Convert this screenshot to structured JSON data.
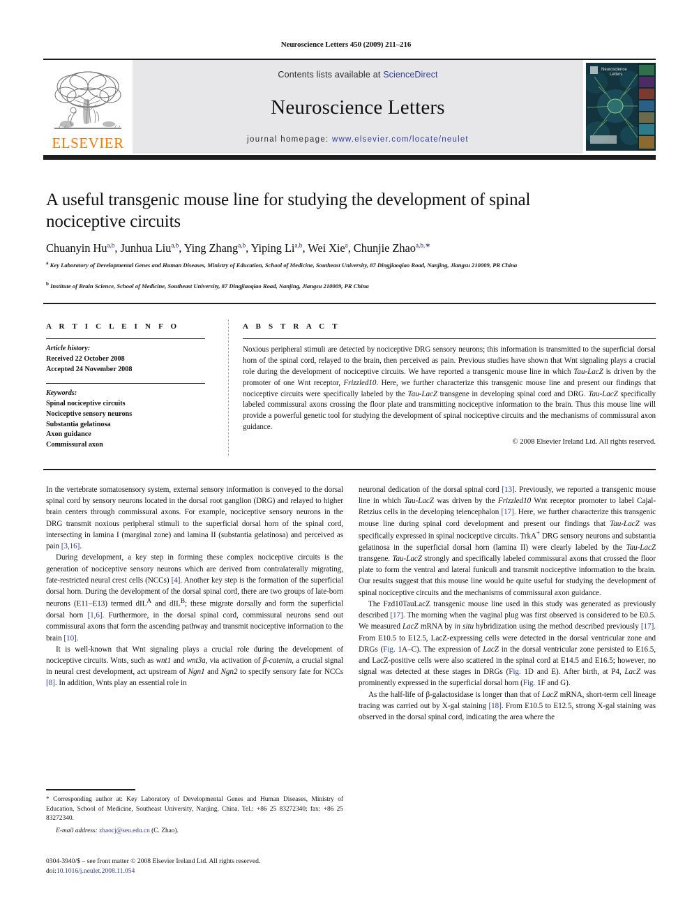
{
  "running_head": "Neuroscience Letters 450 (2009) 211–216",
  "masthead": {
    "publisher_name": "ELSEVIER",
    "contents_prefix": "Contents lists available at ",
    "contents_link": "ScienceDirect",
    "journal_title": "Neuroscience Letters",
    "homepage_prefix": "journal homepage: ",
    "homepage_url": "www.elsevier.com/locate/neulet",
    "cover_title": "Neuroscience Letters",
    "link_color": "#2f3b9e",
    "band_color": "#e7e7e9",
    "elsevier_orange": "#F57C00"
  },
  "article": {
    "title": "A useful transgenic mouse line for studying the development of spinal nociceptive circuits",
    "authors_html": "Chuanyin Hu<sup>a,b</sup>, Junhua Liu<sup>a,b</sup>, Ying Zhang<sup>a,b</sup>, Yiping Li<sup>a,b</sup>, Wei Xie<sup>a</sup>, Chunjie Zhao<sup>a,b,∗</sup>",
    "affiliation_a": "Key Laboratory of Developmental Genes and Human Diseases, Ministry of Education, School of Medicine, Southeast University, 87 Dingjiaoqiao Road, Nanjing, Jiangsu 210009, PR China",
    "affiliation_b": "Institute of Brain Science, School of Medicine, Southeast University, 87 Dingjiaoqiao Road, Nanjing, Jiangsu 210009, PR China"
  },
  "info": {
    "kicker": "A R T I C L E    I N F O",
    "history_label": "Article history:",
    "received": "Received 22 October 2008",
    "accepted": "Accepted 24 November 2008",
    "keywords_label": "Keywords:",
    "keywords": [
      "Spinal nociceptive circuits",
      "Nociceptive sensory neurons",
      "Substantia gelatinosa",
      "Axon guidance",
      "Commissural axon"
    ]
  },
  "abstract": {
    "kicker": "A B S T R A C T",
    "text": "Noxious peripheral stimuli are detected by nociceptive DRG sensory neurons; this information is transmitted to the superficial dorsal horn of the spinal cord, relayed to the brain, then perceived as pain. Previous studies have shown that Wnt signaling plays a crucial role during the development of nociceptive circuits. We have reported a transgenic mouse line in which Tau-LacZ is driven by the promoter of one Wnt receptor, Frizzled10. Here, we further characterize this transgenic mouse line and present our findings that nociceptive circuits were specifically labeled by the Tau-LacZ transgene in developing spinal cord and DRG. Tau-LacZ specifically labeled commissural axons crossing the floor plate and transmitting nociceptive information to the brain. Thus this mouse line will provide a powerful genetic tool for studying the development of spinal nociceptive circuits and the mechanisms of commissural axon guidance.",
    "copyright": "© 2008 Elsevier Ireland Ltd. All rights reserved."
  },
  "body": {
    "left_paragraphs": [
      "In the vertebrate somatosensory system, external sensory information is conveyed to the dorsal spinal cord by sensory neurons located in the dorsal root ganglion (DRG) and relayed to higher brain centers through commissural axons. For example, nociceptive sensory neurons in the DRG transmit noxious peripheral stimuli to the superficial dorsal horn of the spinal cord, intersecting in lamina I (marginal zone) and lamina II (substantia gelatinosa) and perceived as pain [3,16].",
      "During development, a key step in forming these complex nociceptive circuits is the generation of nociceptive sensory neurons which are derived from contralaterally migrating, fate-restricted neural crest cells (NCCs) [4]. Another key step is the formation of the superficial dorsal horn. During the development of the dorsal spinal cord, there are two groups of late-born neurons (E11–E13) termed dIL^A and dIL^B; these migrate dorsally and form the superficial dorsal horn [1,6]. Furthermore, in the dorsal spinal cord, commissural neurons send out commissural axons that form the ascending pathway and transmit nociceptive information to the brain [10].",
      "It is well-known that Wnt signaling plays a crucial role during the development of nociceptive circuits. Wnts, such as wnt1 and wnt3a, via activation of β-catenin, a crucial signal in neural crest development, act upstream of Ngn1 and Ngn2 to specify sensory fate for NCCs [8]. In addition, Wnts play an essential role in"
    ],
    "right_paragraphs": [
      "neuronal dedication of the dorsal spinal cord [13]. Previously, we reported a transgenic mouse line in which Tau-LacZ was driven by the Frizzled10 Wnt receptor promoter to label Cajal-Retzius cells in the developing telencephalon [17]. Here, we further characterize this transgenic mouse line during spinal cord development and present our findings that Tau-LacZ was specifically expressed in spinal nociceptive circuits. TrkA+ DRG sensory neurons and substantia gelatinosa in the superficial dorsal horn (lamina II) were clearly labeled by the Tau-LacZ transgene. Tau-LacZ strongly and specifically labeled commissural axons that crossed the floor plate to form the ventral and lateral funiculi and transmit nociceptive information to the brain. Our results suggest that this mouse line would be quite useful for studying the development of spinal nociceptive circuits and the mechanisms of commissural axon guidance.",
      "The Fzd10TauLacZ transgenic mouse line used in this study was generated as previously described [17]. The morning when the vaginal plug was first observed is considered to be E0.5. We measured LacZ mRNA by in situ hybridization using the method described previously [17]. From E10.5 to E12.5, LacZ-expressing cells were detected in the dorsal ventricular zone and DRGs (Fig. 1A–C). The expression of LacZ in the dorsal ventricular zone persisted to E16.5, and LacZ-positive cells were also scattered in the spinal cord at E14.5 and E16.5; however, no signal was detected at these stages in DRGs (Fig. 1D and E). After birth, at P4, LacZ was prominently expressed in the superficial dorsal horn (Fig. 1F and G).",
      "As the half-life of β-galactosidase is longer than that of LacZ mRNA, short-term cell lineage tracing was carried out by X-gal staining [18]. From E10.5 to E12.5, strong X-gal staining was observed in the dorsal spinal cord, indicating the area where the"
    ]
  },
  "footnotes": {
    "corresponding": "* Corresponding author at: Key Laboratory of Developmental Genes and Human Diseases, Ministry of Education, School of Medicine, Southeast University, Nanjing, China. Tel.: +86 25 83272340; fax: +86 25 83272340.",
    "email_label": "E-mail address:",
    "email_address": "zhaocj@seu.edu.cn",
    "email_suffix": "(C. Zhao).",
    "issn_line": "0304-3940/$ – see front matter © 2008 Elsevier Ireland Ltd. All rights reserved.",
    "doi_label": "doi:",
    "doi_value": "10.1016/j.neulet.2008.11.054"
  }
}
